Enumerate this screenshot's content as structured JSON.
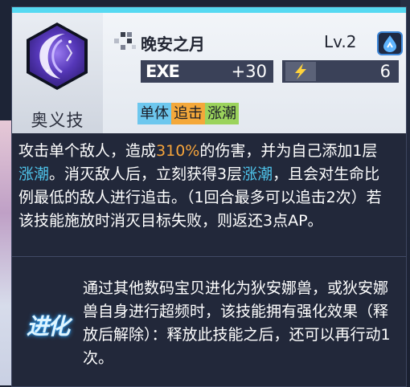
{
  "skill": {
    "type_label": "奥义技",
    "name": "晚安之月",
    "level": "Lv.2",
    "exe_label": "EXE",
    "exe_value": "+30",
    "ap_value": "6",
    "tags": [
      "单体",
      "追击",
      "涨潮"
    ],
    "icon": "crescent-moon-icon"
  },
  "description": {
    "segments": [
      {
        "text": "攻击单个敌人，造成",
        "style": "normal"
      },
      {
        "text": "310%",
        "style": "num"
      },
      {
        "text": "的伤害，并为自己添加1层",
        "style": "normal"
      },
      {
        "text": "涨潮",
        "style": "key"
      },
      {
        "text": "。消灭敌人后，立刻获得3层",
        "style": "normal"
      },
      {
        "text": "涨潮",
        "style": "key"
      },
      {
        "text": "，且会对生命比例最低的敌人进行追击。（1回合最多可以追击2次）若该技能施放时消灭目标失败，则返还3点AP。",
        "style": "normal"
      }
    ]
  },
  "evolution": {
    "badge": "进化",
    "text": "通过其他数码宝贝进化为狄安娜兽，或狄安娜兽自身进行超频时，该技能拥有强化效果（释放后解除）：释放此技能之后，还可以再行动1次。"
  },
  "colors": {
    "accent": "#55d9f2",
    "highlight_number": "#f6a43a",
    "highlight_keyword": "#4ec3ea",
    "tag_colors": [
      "#6dc7ee",
      "#f4a83a",
      "#9bd35c"
    ]
  }
}
